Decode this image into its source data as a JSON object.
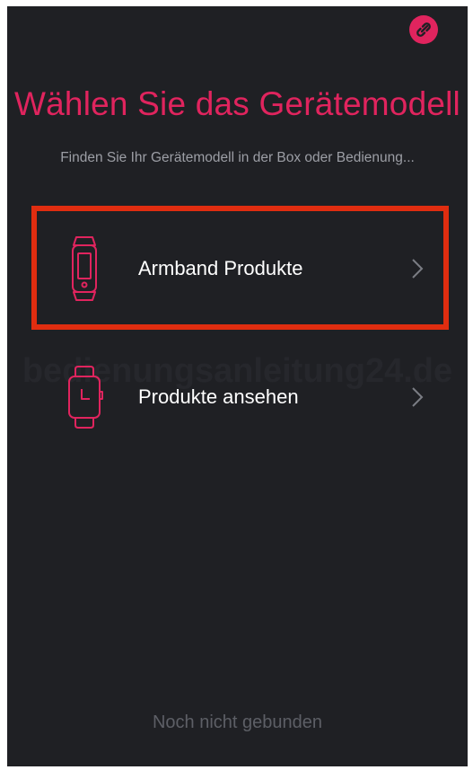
{
  "header": {
    "link_icon": "link-icon",
    "title": "Wählen Sie das Gerätemodell",
    "subtitle": "Finden Sie Ihr Gerätemodell in der Box oder Bedienung..."
  },
  "options": [
    {
      "label": "Armband Produkte",
      "icon": "fitness-band-icon",
      "chevron": "chevron-right-icon",
      "highlighted": true
    },
    {
      "label": "Produkte ansehen",
      "icon": "smartwatch-icon",
      "chevron": "chevron-right-icon",
      "highlighted": false
    }
  ],
  "watermark": "bedienungsanleitung24.de",
  "footer": {
    "status": "Noch nicht gebunden"
  },
  "colors": {
    "background": "#1f2024",
    "accent": "#e0245e",
    "highlight_frame": "#e02d10",
    "subtitle_text": "#9c9ea5",
    "footer_text": "#5d5f66"
  }
}
